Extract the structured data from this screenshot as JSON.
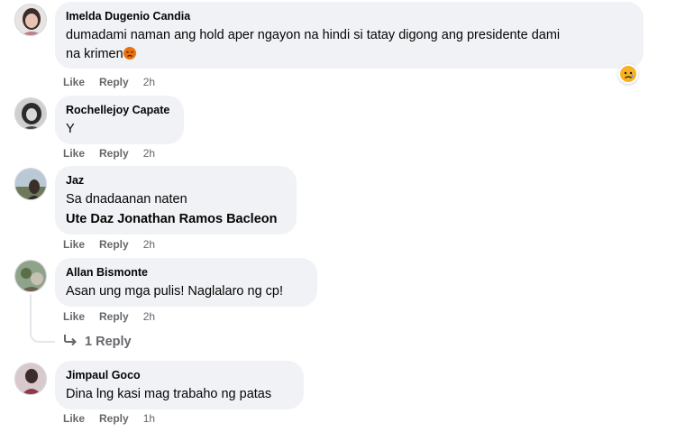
{
  "comments": [
    {
      "author": "Imelda Dugenio Candia",
      "text_line1": "dumadami naman ang hold aper ngayon na hindi si tatay digong ang presidente dami",
      "text_line2": "na krimen",
      "text_emoji": "angry-face-emoji",
      "reaction_icon": "sad-face-reaction-icon",
      "actions": {
        "like": "Like",
        "reply": "Reply",
        "time": "2h"
      }
    },
    {
      "author": "Rochellejoy Capate",
      "text": "Y",
      "actions": {
        "like": "Like",
        "reply": "Reply",
        "time": "2h"
      }
    },
    {
      "author": "Jaz",
      "text": "Sa dnadaanan naten",
      "mention": "Ute Daz Jonathan Ramos Bacleon",
      "actions": {
        "like": "Like",
        "reply": "Reply",
        "time": "2h"
      }
    },
    {
      "author": "Allan Bismonte",
      "text": "Asan ung mga pulis! Naglalaro ng cp!",
      "actions": {
        "like": "Like",
        "reply": "Reply",
        "time": "2h"
      },
      "replies_link": "1 Reply"
    },
    {
      "author": "Jimpaul Goco",
      "text": "Dina lng kasi mag trabaho ng patas",
      "actions": {
        "like": "Like",
        "reply": "Reply",
        "time": "1h"
      }
    }
  ],
  "colors": {
    "bubble": "#f0f2f5",
    "meta_text": "#65676b",
    "text": "#050505",
    "thread_line": "#e4e6eb"
  }
}
